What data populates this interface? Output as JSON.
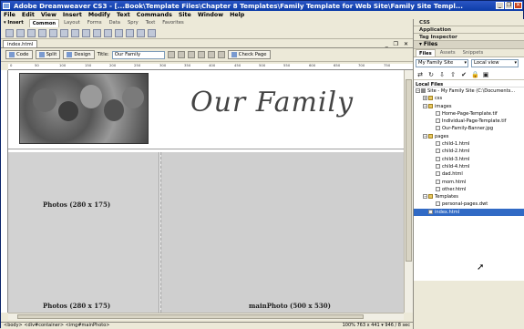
{
  "window": {
    "title": "Adobe Dreamweaver CS3 - [...Book\\Template Files\\Chapter 8 Templates\\Family Template for Web Site\\Family Site Templ...",
    "controls": [
      "_",
      "❐",
      "✕"
    ]
  },
  "menubar": [
    "File",
    "Edit",
    "View",
    "Insert",
    "Modify",
    "Text",
    "Commands",
    "Site",
    "Window",
    "Help"
  ],
  "insert_bar": {
    "label": "▾ Insert",
    "tabs": [
      "Common",
      "Layout",
      "Forms",
      "Data",
      "Spry",
      "Text",
      "Favorites"
    ],
    "active_tab": "Common"
  },
  "document": {
    "tab": "index.html",
    "controls": "_ ❐ ✕",
    "views": [
      "Code",
      "Split",
      "Design"
    ],
    "title_label": "Title:",
    "title_value": "Our Family",
    "check_page": "Check Page",
    "heading": "Our Family",
    "placeholders": {
      "photo_top": "Photos (280 x 175)",
      "photo_bottom": "Photos (280 x 175)",
      "main_photo": "mainPhoto (500 x 530)"
    },
    "ruler_marks": [
      "0",
      "50",
      "100",
      "150",
      "200",
      "250",
      "300",
      "350",
      "400",
      "450",
      "500",
      "550",
      "600",
      "650",
      "700",
      "750"
    ]
  },
  "status": {
    "tag_selector": "<body> <div#container> <img#mainPhoto>",
    "zoom": "100%",
    "size": "763 x 441 ▾ 946 / 8 sec"
  },
  "panels": {
    "collapsed": [
      "CSS",
      "Application",
      "Tag Inspector"
    ],
    "files_title": "▾ Files",
    "files_tabs": [
      "Files",
      "Assets",
      "Snippets"
    ],
    "site_select": "My Family Site",
    "view_select": "Local view",
    "tree_header": "Local Files",
    "tree": [
      {
        "label": "Site - My Family Site (C:\\Documents...",
        "type": "site",
        "depth": 0
      },
      {
        "label": "css",
        "type": "folder",
        "depth": 1
      },
      {
        "label": "images",
        "type": "folder",
        "depth": 1
      },
      {
        "label": "Home-Page-Template.tif",
        "type": "file",
        "depth": 2
      },
      {
        "label": "Individual-Page-Template.tif",
        "type": "file",
        "depth": 2
      },
      {
        "label": "Our-Family-Banner.jpg",
        "type": "file",
        "depth": 2
      },
      {
        "label": "pages",
        "type": "folder",
        "depth": 1
      },
      {
        "label": "child-1.html",
        "type": "file",
        "depth": 2
      },
      {
        "label": "child-2.html",
        "type": "file",
        "depth": 2
      },
      {
        "label": "child-3.html",
        "type": "file",
        "depth": 2
      },
      {
        "label": "child-4.html",
        "type": "file",
        "depth": 2
      },
      {
        "label": "dad.html",
        "type": "file",
        "depth": 2
      },
      {
        "label": "mom.html",
        "type": "file",
        "depth": 2
      },
      {
        "label": "other.html",
        "type": "file",
        "depth": 2
      },
      {
        "label": "Templates",
        "type": "folder",
        "depth": 1
      },
      {
        "label": "personal-pages.dwt",
        "type": "file",
        "depth": 2
      },
      {
        "label": "index.html",
        "type": "file",
        "depth": 1,
        "selected": true
      }
    ]
  }
}
